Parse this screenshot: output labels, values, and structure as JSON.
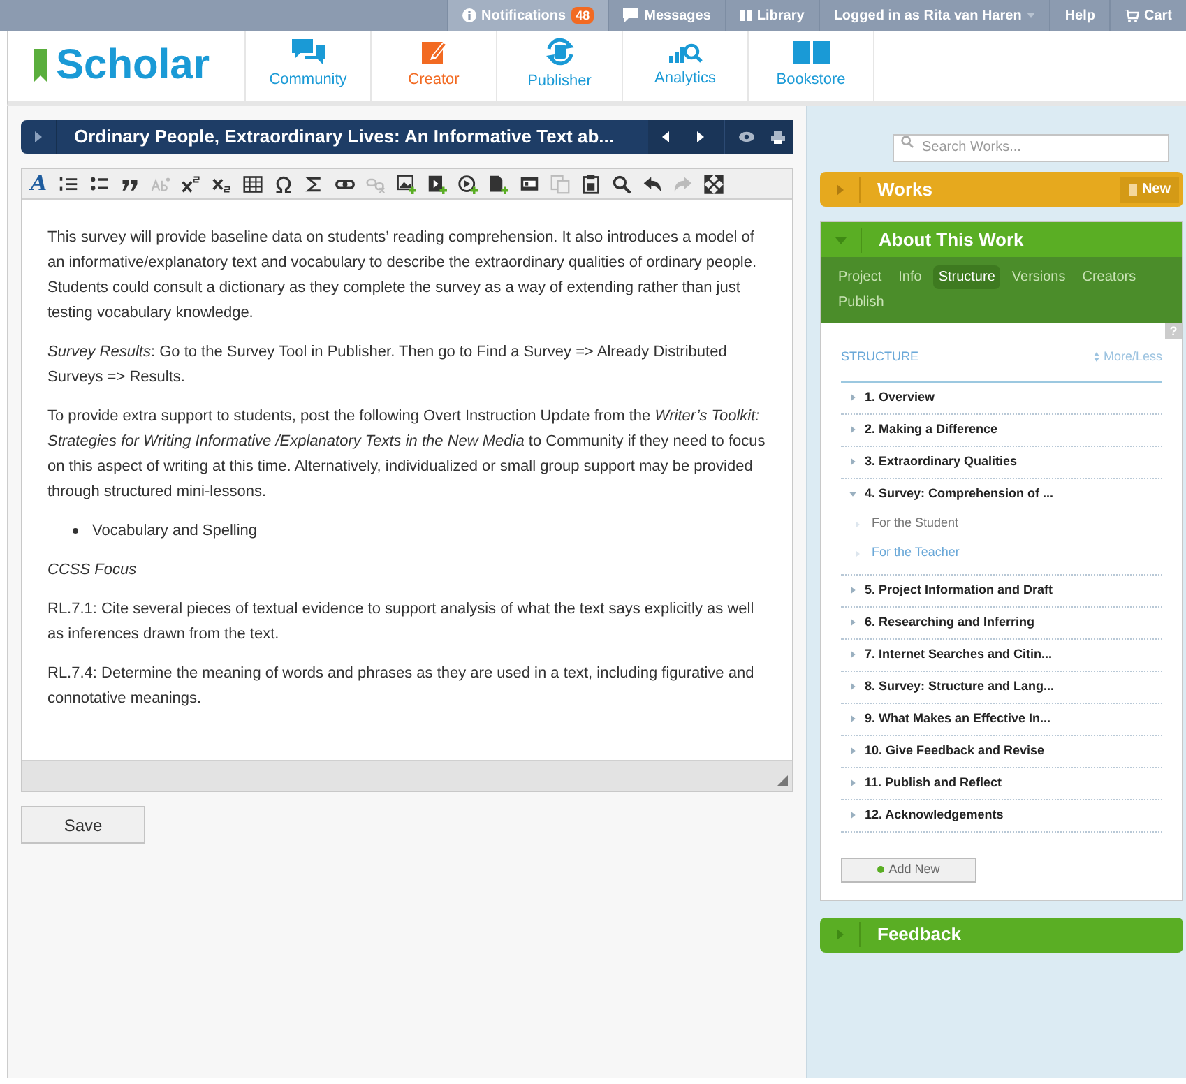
{
  "top_bar": {
    "items": [
      {
        "label": "Notifications",
        "badge": "48",
        "active": true
      },
      {
        "label": "Messages",
        "active": false
      },
      {
        "label": "Library",
        "active": false
      },
      {
        "label": "Logged in as Rita van Haren",
        "active": false
      },
      {
        "label": "Help",
        "active": false
      },
      {
        "label": "Cart",
        "active": false
      }
    ]
  },
  "logo": "Scholar",
  "nav": [
    {
      "label": "Community",
      "selected": false
    },
    {
      "label": "Creator",
      "selected": true
    },
    {
      "label": "Publisher",
      "selected": false
    },
    {
      "label": "Analytics",
      "selected": false
    },
    {
      "label": "Bookstore",
      "selected": false
    }
  ],
  "document": {
    "title": "Ordinary People, Extraordinary Lives: An Informative Text ab..."
  },
  "toolbar": [
    {
      "kind": "font",
      "glyph": "A",
      "disabled": false
    },
    {
      "kind": "numbered",
      "disabled": false
    },
    {
      "kind": "bullets",
      "disabled": false
    },
    {
      "kind": "quote",
      "disabled": false
    },
    {
      "kind": "ab",
      "disabled": true
    },
    {
      "kind": "sup",
      "disabled": false
    },
    {
      "kind": "sub",
      "disabled": false
    },
    {
      "kind": "table",
      "disabled": false
    },
    {
      "kind": "omega",
      "disabled": false
    },
    {
      "kind": "sigma",
      "disabled": false
    },
    {
      "kind": "link",
      "disabled": false
    },
    {
      "kind": "unlink",
      "disabled": true
    },
    {
      "kind": "image",
      "disabled": false
    },
    {
      "kind": "video",
      "disabled": false
    },
    {
      "kind": "play",
      "disabled": false
    },
    {
      "kind": "file",
      "disabled": false
    },
    {
      "kind": "media",
      "disabled": false
    },
    {
      "kind": "copy",
      "disabled": true
    },
    {
      "kind": "paste",
      "disabled": false
    },
    {
      "kind": "search",
      "disabled": false
    },
    {
      "kind": "undo",
      "disabled": false
    },
    {
      "kind": "redo",
      "disabled": true
    },
    {
      "kind": "fullscreen",
      "disabled": false
    }
  ],
  "content": [
    {
      "kind": "p",
      "text": "This survey will provide baseline data on students’ reading comprehension. It also introduces a model of an informative/explanatory text and vocabulary to describe the extraordinary qualities of ordinary people. Students could consult a dictionary as they complete the survey as a way of extending rather than just testing vocabulary knowledge."
    },
    {
      "kind": "p",
      "text": "*Survey Results*: Go to the Survey Tool in Publisher. Then go to Find a Survey => Already Distributed Surveys => Results."
    },
    {
      "kind": "p",
      "text": "To provide extra support to students, post the following Overt Instruction Update from the *Writer’s Toolkit: Strategies for Writing Informative /Explanatory Texts in the New Media* to Community if they need to focus on this aspect of writing at this time. Alternatively, individualized or small group support may be provided through structured mini-lessons."
    },
    {
      "kind": "bullet",
      "text": "Vocabulary and Spelling"
    },
    {
      "kind": "italic",
      "text": "CCSS Focus"
    },
    {
      "kind": "p",
      "text": "RL.7.1: Cite several pieces of textual evidence to support analysis of what the text says explicitly as well as inferences drawn from the text."
    },
    {
      "kind": "p",
      "text": "RL.7.4: Determine the meaning of words and phrases as they are used in a text, including figurative and connotative meanings."
    }
  ],
  "save_button": "Save",
  "search": {
    "placeholder": "Search Works..."
  },
  "works": {
    "title": "Works",
    "button": "New",
    "expanded": false
  },
  "about": {
    "title": "About This Work",
    "expanded": true,
    "tabs": [
      {
        "label": "Project",
        "selected": false
      },
      {
        "label": "Info",
        "selected": false
      },
      {
        "label": "Structure",
        "selected": true
      },
      {
        "label": "Versions",
        "selected": false
      },
      {
        "label": "Creators",
        "selected": false
      },
      {
        "label": "Publish",
        "selected": false
      }
    ],
    "help": "?",
    "heading": "STRUCTURE",
    "more_less": "More/Less",
    "items": [
      {
        "label": "1. Overview",
        "expanded": false
      },
      {
        "label": "2. Making a Difference",
        "expanded": false
      },
      {
        "label": "3. Extraordinary Qualities",
        "expanded": false
      },
      {
        "label": "4. Survey: Comprehension of ...",
        "expanded": true,
        "children": [
          {
            "label": "For the Student",
            "selected": false
          },
          {
            "label": "For the Teacher",
            "selected": true
          }
        ]
      },
      {
        "label": "5. Project Information and Draft",
        "expanded": false
      },
      {
        "label": "6. Researching and Inferring",
        "expanded": false
      },
      {
        "label": "7. Internet Searches and Citin...",
        "expanded": false
      },
      {
        "label": "8. Survey: Structure and Lang...",
        "expanded": false
      },
      {
        "label": "9. What Makes an Effective In...",
        "expanded": false
      },
      {
        "label": "10. Give Feedback and Revise",
        "expanded": false
      },
      {
        "label": "11. Publish and Reflect",
        "expanded": false
      },
      {
        "label": "12. Acknowledgements",
        "expanded": false
      }
    ],
    "add_button": "Add New"
  },
  "feedback": {
    "title": "Feedback",
    "expanded": false
  }
}
